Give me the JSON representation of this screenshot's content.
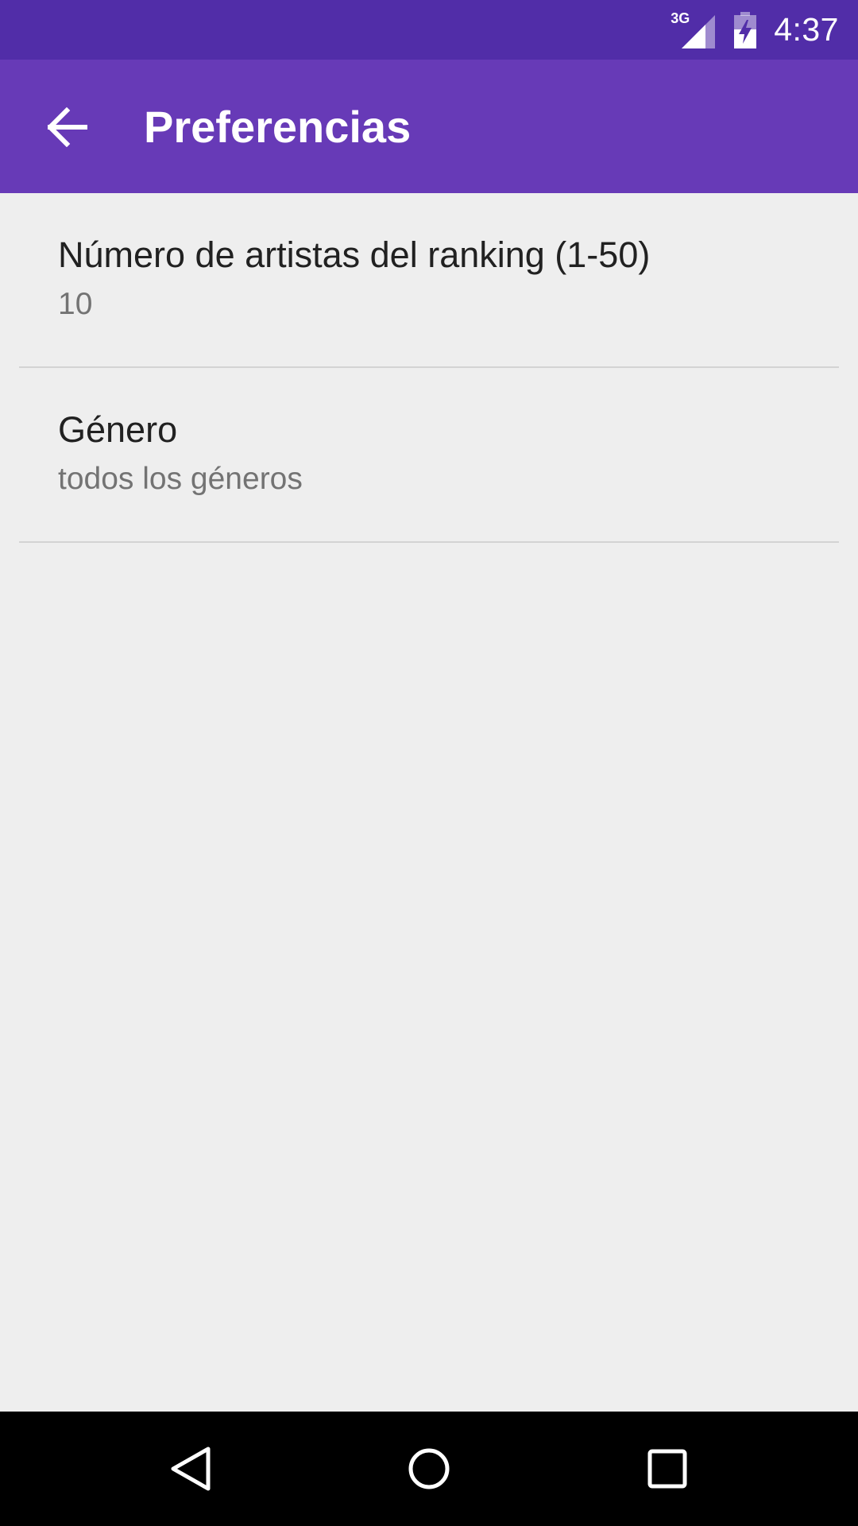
{
  "status_bar": {
    "network_type": "3G",
    "time": "4:37",
    "icons": [
      "signal-icon",
      "battery-charging-icon"
    ]
  },
  "app_bar": {
    "title": "Preferencias",
    "back_icon": "arrow-back-icon"
  },
  "preferences": [
    {
      "title": "Número de artistas del ranking (1-50)",
      "summary": "10"
    },
    {
      "title": "Género",
      "summary": "todos los géneros"
    }
  ],
  "nav_bar": {
    "icons": [
      "back-triangle-icon",
      "home-circle-icon",
      "recents-square-icon"
    ]
  },
  "colors": {
    "status_bar": "#512da8",
    "app_bar": "#673ab7",
    "background": "#eeeeee",
    "divider": "#d3d3d3",
    "title_text": "#212121",
    "summary_text": "#737373"
  }
}
